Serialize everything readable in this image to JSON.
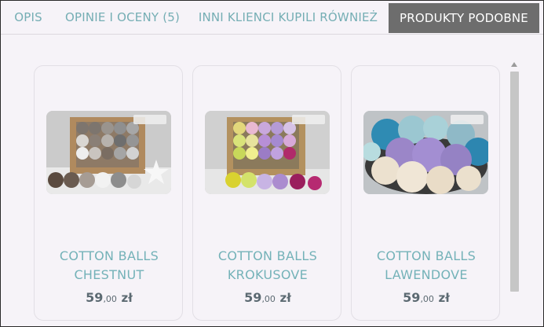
{
  "tabs": [
    {
      "label": "OPIS"
    },
    {
      "label": "OPINIE I OCENY (5)"
    },
    {
      "label": "INNI KLIENCI KUPILI RÓWNIEŻ"
    },
    {
      "label": "PRODUKTY PODOBNE",
      "active": true
    }
  ],
  "products": [
    {
      "name_line1": "COTTON BALLS",
      "name_line2": "CHESTNUT",
      "price_main": "59",
      "price_cents": ",00",
      "currency": "zł"
    },
    {
      "name_line1": "COTTON BALLS",
      "name_line2": "KROKUSOVE",
      "price_main": "59",
      "price_cents": ",00",
      "currency": "zł"
    },
    {
      "name_line1": "COTTON BALLS",
      "name_line2": "LAWENDOVE",
      "price_main": "59",
      "price_cents": ",00",
      "currency": "zł"
    }
  ],
  "colors": {
    "accent_teal": "#74b2b8",
    "active_tab_bg": "#6d6d6d",
    "page_bg": "#f6f3f8",
    "price_text": "#5c6a72"
  }
}
